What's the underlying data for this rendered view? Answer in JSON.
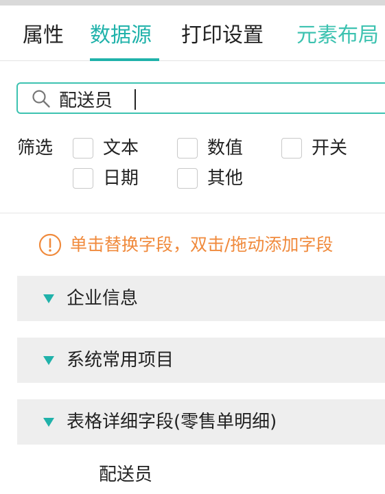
{
  "tabs": [
    {
      "label": "属性"
    },
    {
      "label": "数据源"
    },
    {
      "label": "打印设置"
    },
    {
      "label": "元素布局"
    }
  ],
  "search": {
    "value": "配送员",
    "icon": "search-icon"
  },
  "filter": {
    "label": "筛选",
    "options": [
      {
        "label": "文本"
      },
      {
        "label": "数值"
      },
      {
        "label": "开关"
      },
      {
        "label": "日期"
      },
      {
        "label": "其他"
      }
    ]
  },
  "notice": {
    "text": "单击替换字段，双击/拖动添加字段",
    "color": "#f08a3c"
  },
  "groups": [
    {
      "label": "企业信息"
    },
    {
      "label": "系统常用项目"
    },
    {
      "label": "表格详细字段(零售单明细)"
    }
  ],
  "fields": [
    {
      "label": "配送员"
    }
  ],
  "colors": {
    "accent": "#20b2aa",
    "notice": "#f08a3c"
  }
}
